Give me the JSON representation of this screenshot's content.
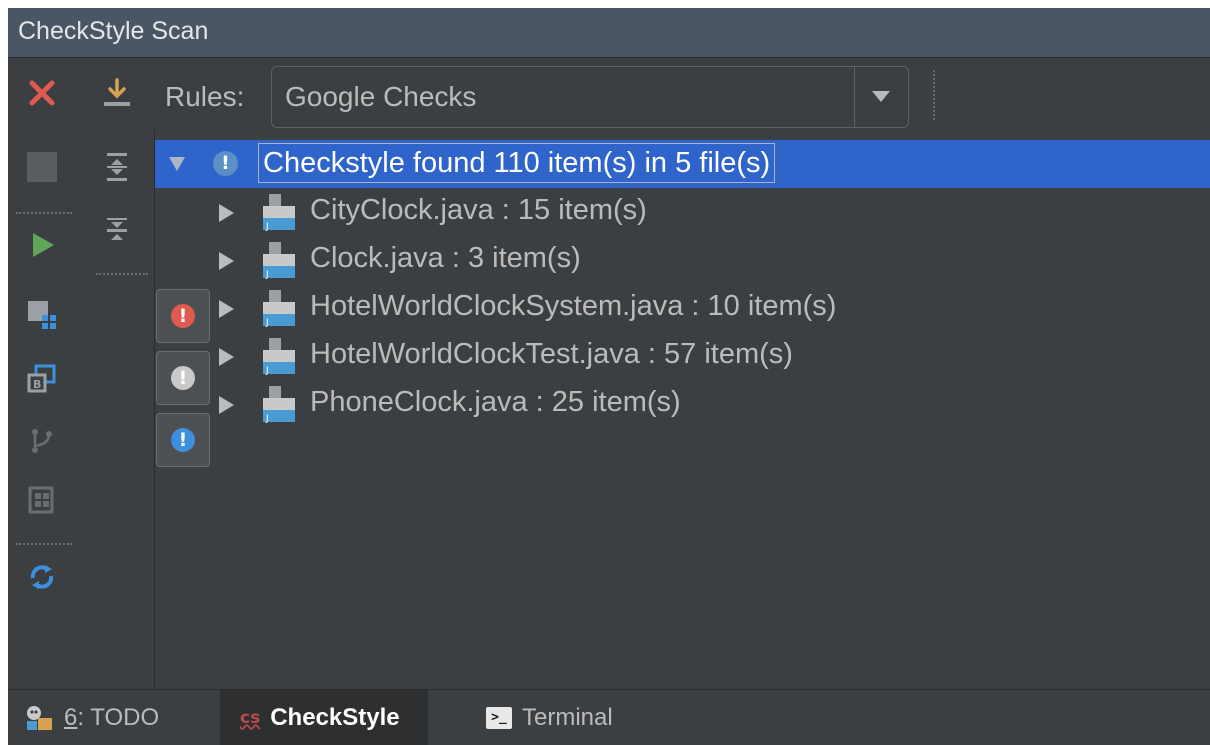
{
  "panel": {
    "title": "CheckStyle Scan"
  },
  "toolbar": {
    "rules_label": "Rules:",
    "rules_selected": "Google Checks"
  },
  "tree": {
    "root": "Checkstyle found 110 item(s) in 5 file(s)",
    "files": [
      "CityClock.java : 15 item(s)",
      "Clock.java : 3 item(s)",
      "HotelWorldClockSystem.java : 10 item(s)",
      "HotelWorldClockTest.java : 57 item(s)",
      "PhoneClock.java : 25 item(s)"
    ]
  },
  "tabs": {
    "todo_number": "6",
    "todo_label": ": TODO",
    "checkstyle": "CheckStyle",
    "terminal": "Terminal"
  },
  "icons": {
    "close": "close-icon",
    "import": "import-icon",
    "stop": "stop-icon",
    "expand_all": "expand-all-icon",
    "collapse_all": "collapse-all-icon",
    "run": "run-icon",
    "filter_errors": "error-filter-icon",
    "filter_warnings": "warning-filter-icon",
    "filter_info": "info-filter-icon",
    "reload": "reload-icon"
  },
  "colors": {
    "selection": "#2f65ca",
    "error": "#e05a4f",
    "warning": "#c9c9c9",
    "info": "#3d8fe0",
    "run": "#5fa65a"
  }
}
